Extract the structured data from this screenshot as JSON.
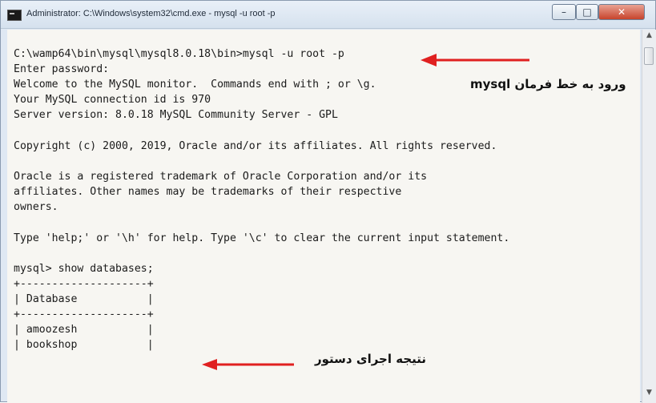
{
  "window": {
    "title": "Administrator: C:\\Windows\\system32\\cmd.exe - mysql  -u root -p",
    "controls": {
      "minimize": "–",
      "maximize": "□",
      "close": "✕"
    }
  },
  "console": {
    "lines": [
      "C:\\wamp64\\bin\\mysql\\mysql8.0.18\\bin>mysql -u root -p",
      "Enter password:",
      "Welcome to the MySQL monitor.  Commands end with ; or \\g.",
      "Your MySQL connection id is 970",
      "Server version: 8.0.18 MySQL Community Server - GPL",
      "Copyright (c) 2000, 2019, Oracle and/or its affiliates. All rights reserved.",
      "Oracle is a registered trademark of Oracle Corporation and/or its",
      "affiliates. Other names may be trademarks of their respective",
      "owners.",
      "Type 'help;' or '\\h' for help. Type '\\c' to clear the current input statement.",
      "mysql> show databases;",
      "+--------------------+",
      "| Database           |",
      "+--------------------+",
      "| amoozesh           |",
      "| bookshop           |"
    ]
  },
  "annotations": {
    "login": "ورود به خط فرمان mysql",
    "result": "نتیجه اجرای دستور"
  },
  "colors": {
    "arrow": "#e02020",
    "console_bg": "#f7f6f2"
  },
  "icons": {
    "window": "cmd-icon",
    "scroll_up": "scroll-up-arrow-icon",
    "scroll_down": "scroll-down-arrow-icon"
  }
}
